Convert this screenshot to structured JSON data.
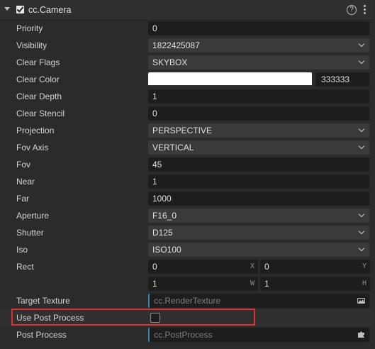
{
  "header": {
    "title": "cc.Camera",
    "enabled": true,
    "help_glyph": "?"
  },
  "rows": {
    "priority": {
      "label": "Priority",
      "value": "0"
    },
    "visibility": {
      "label": "Visibility",
      "value": "1822425087"
    },
    "clear_flags": {
      "label": "Clear Flags",
      "value": "SKYBOX"
    },
    "clear_color": {
      "label": "Clear Color",
      "hex": "333333",
      "swatch": "#ffffff"
    },
    "clear_depth": {
      "label": "Clear Depth",
      "value": "1"
    },
    "clear_stencil": {
      "label": "Clear Stencil",
      "value": "0"
    },
    "projection": {
      "label": "Projection",
      "value": "PERSPECTIVE"
    },
    "fov_axis": {
      "label": "Fov Axis",
      "value": "VERTICAL"
    },
    "fov": {
      "label": "Fov",
      "value": "45"
    },
    "near": {
      "label": "Near",
      "value": "1"
    },
    "far": {
      "label": "Far",
      "value": "1000"
    },
    "aperture": {
      "label": "Aperture",
      "value": "F16_0"
    },
    "shutter": {
      "label": "Shutter",
      "value": "D125"
    },
    "iso": {
      "label": "Iso",
      "value": "ISO100"
    },
    "rect": {
      "label": "Rect",
      "x": "0",
      "y": "0",
      "w": "1",
      "h": "1",
      "x_axis": "X",
      "y_axis": "Y",
      "w_axis": "W",
      "h_axis": "H"
    },
    "target_texture": {
      "label": "Target Texture",
      "placeholder": "cc.RenderTexture"
    },
    "use_post_process": {
      "label": "Use Post Process",
      "checked": false
    },
    "post_process": {
      "label": "Post Process",
      "placeholder": "cc.PostProcess"
    }
  },
  "colors": {
    "highlight": "#e03131",
    "asset_accent": "#2e88b8"
  }
}
